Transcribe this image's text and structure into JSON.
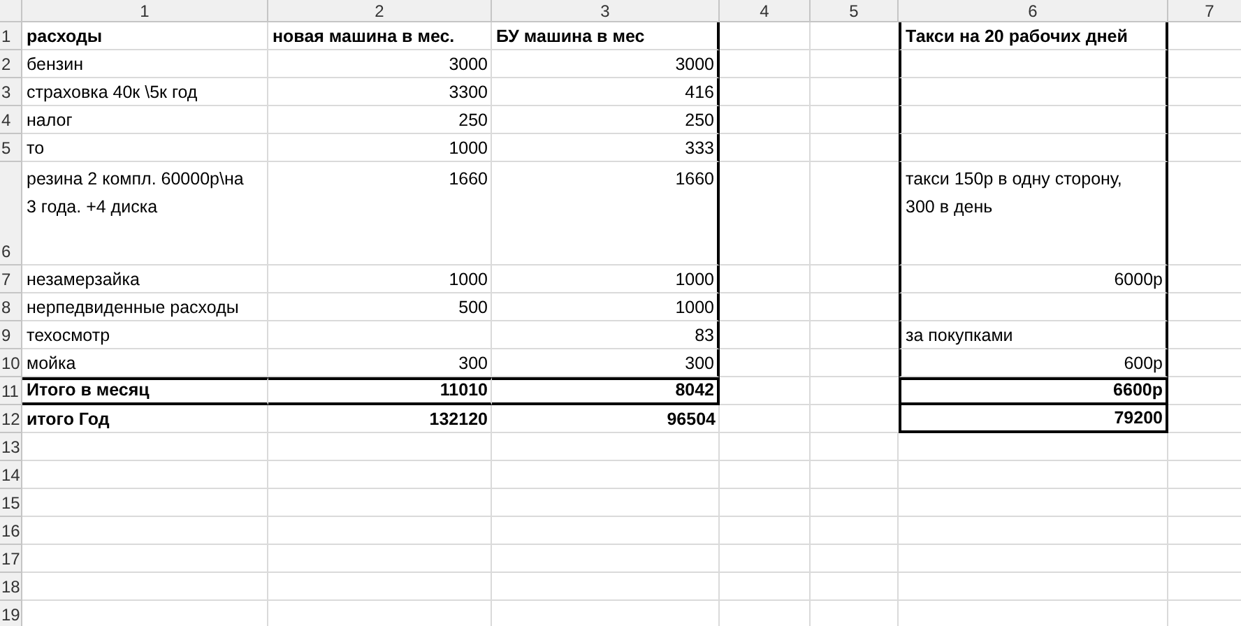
{
  "columns": [
    "1",
    "2",
    "3",
    "4",
    "5",
    "6",
    "7"
  ],
  "rows": [
    {
      "number": "1",
      "kind": "header",
      "cells": {
        "c1": {
          "kind": "text",
          "text": "расходы"
        },
        "c2": {
          "kind": "text",
          "text": "новая машина в мес."
        },
        "c3": {
          "kind": "text",
          "text": "БУ машина в мес"
        },
        "c6": {
          "kind": "text",
          "text": "Такси на 20 рабочих дней"
        }
      }
    },
    {
      "number": "2",
      "kind": "item",
      "cells": {
        "c1": {
          "kind": "text",
          "text": "бензин"
        },
        "c2": {
          "kind": "number",
          "text": "3000"
        },
        "c3": {
          "kind": "number",
          "text": "3000"
        }
      }
    },
    {
      "number": "3",
      "kind": "item",
      "cells": {
        "c1": {
          "kind": "text",
          "text": "страховка 40к \\5к  год"
        },
        "c2": {
          "kind": "number",
          "text": "3300"
        },
        "c3": {
          "kind": "number",
          "text": "416"
        }
      }
    },
    {
      "number": "4",
      "kind": "item",
      "cells": {
        "c1": {
          "kind": "text",
          "text": "налог"
        },
        "c2": {
          "kind": "number",
          "text": "250"
        },
        "c3": {
          "kind": "number",
          "text": "250"
        }
      }
    },
    {
      "number": "5",
      "kind": "item",
      "cells": {
        "c1": {
          "kind": "text",
          "text": "то"
        },
        "c2": {
          "kind": "number",
          "text": "1000"
        },
        "c3": {
          "kind": "number",
          "text": "333"
        }
      }
    },
    {
      "number": "6",
      "kind": "wrapped",
      "cells": {
        "c1": {
          "kind": "text",
          "text": "резина 2 компл. 60000р\\на 3 года. +4 диска"
        },
        "c2": {
          "kind": "number",
          "text": "1660"
        },
        "c3": {
          "kind": "number",
          "text": "1660"
        },
        "c6": {
          "kind": "text",
          "text": "такси 150р в одну сторону, 300 в день"
        }
      }
    },
    {
      "number": "7",
      "kind": "item",
      "cells": {
        "c1": {
          "kind": "text",
          "text": "незамерзайка"
        },
        "c2": {
          "kind": "number",
          "text": "1000"
        },
        "c3": {
          "kind": "number",
          "text": "1000"
        },
        "c6": {
          "kind": "number",
          "text": "6000р"
        }
      }
    },
    {
      "number": "8",
      "kind": "item",
      "cells": {
        "c1": {
          "kind": "text",
          "text": "нерпедвиденные расходы"
        },
        "c2": {
          "kind": "number",
          "text": "500"
        },
        "c3": {
          "kind": "number",
          "text": "1000"
        }
      }
    },
    {
      "number": "9",
      "kind": "item",
      "cells": {
        "c1": {
          "kind": "text",
          "text": "техосмотр"
        },
        "c3": {
          "kind": "number",
          "text": "83"
        },
        "c6": {
          "kind": "text",
          "text": "за покупками"
        }
      }
    },
    {
      "number": "10",
      "kind": "item",
      "cells": {
        "c1": {
          "kind": "text",
          "text": "мойка"
        },
        "c2": {
          "kind": "number",
          "text": "300"
        },
        "c3": {
          "kind": "number",
          "text": "300"
        },
        "c6": {
          "kind": "number",
          "text": "600р"
        }
      }
    },
    {
      "number": "11",
      "kind": "subtotal",
      "cells": {
        "c1": {
          "kind": "text",
          "text": "Итого в месяц"
        },
        "c2": {
          "kind": "number",
          "text": "11010"
        },
        "c3": {
          "kind": "number",
          "text": "8042"
        },
        "c6": {
          "kind": "number",
          "text": "6600р"
        }
      }
    },
    {
      "number": "12",
      "kind": "total",
      "cells": {
        "c1": {
          "kind": "text",
          "text": "итого Год"
        },
        "c2": {
          "kind": "number",
          "text": "132120"
        },
        "c3": {
          "kind": "number",
          "text": "96504"
        },
        "c6": {
          "kind": "number",
          "text": "79200"
        }
      }
    },
    {
      "number": "13",
      "kind": "empty",
      "cells": {}
    },
    {
      "number": "14",
      "kind": "empty",
      "cells": {}
    },
    {
      "number": "15",
      "kind": "empty",
      "cells": {}
    },
    {
      "number": "16",
      "kind": "empty",
      "cells": {}
    },
    {
      "number": "17",
      "kind": "empty",
      "cells": {}
    },
    {
      "number": "18",
      "kind": "empty",
      "cells": {}
    },
    {
      "number": "19",
      "kind": "empty",
      "cells": {}
    }
  ]
}
